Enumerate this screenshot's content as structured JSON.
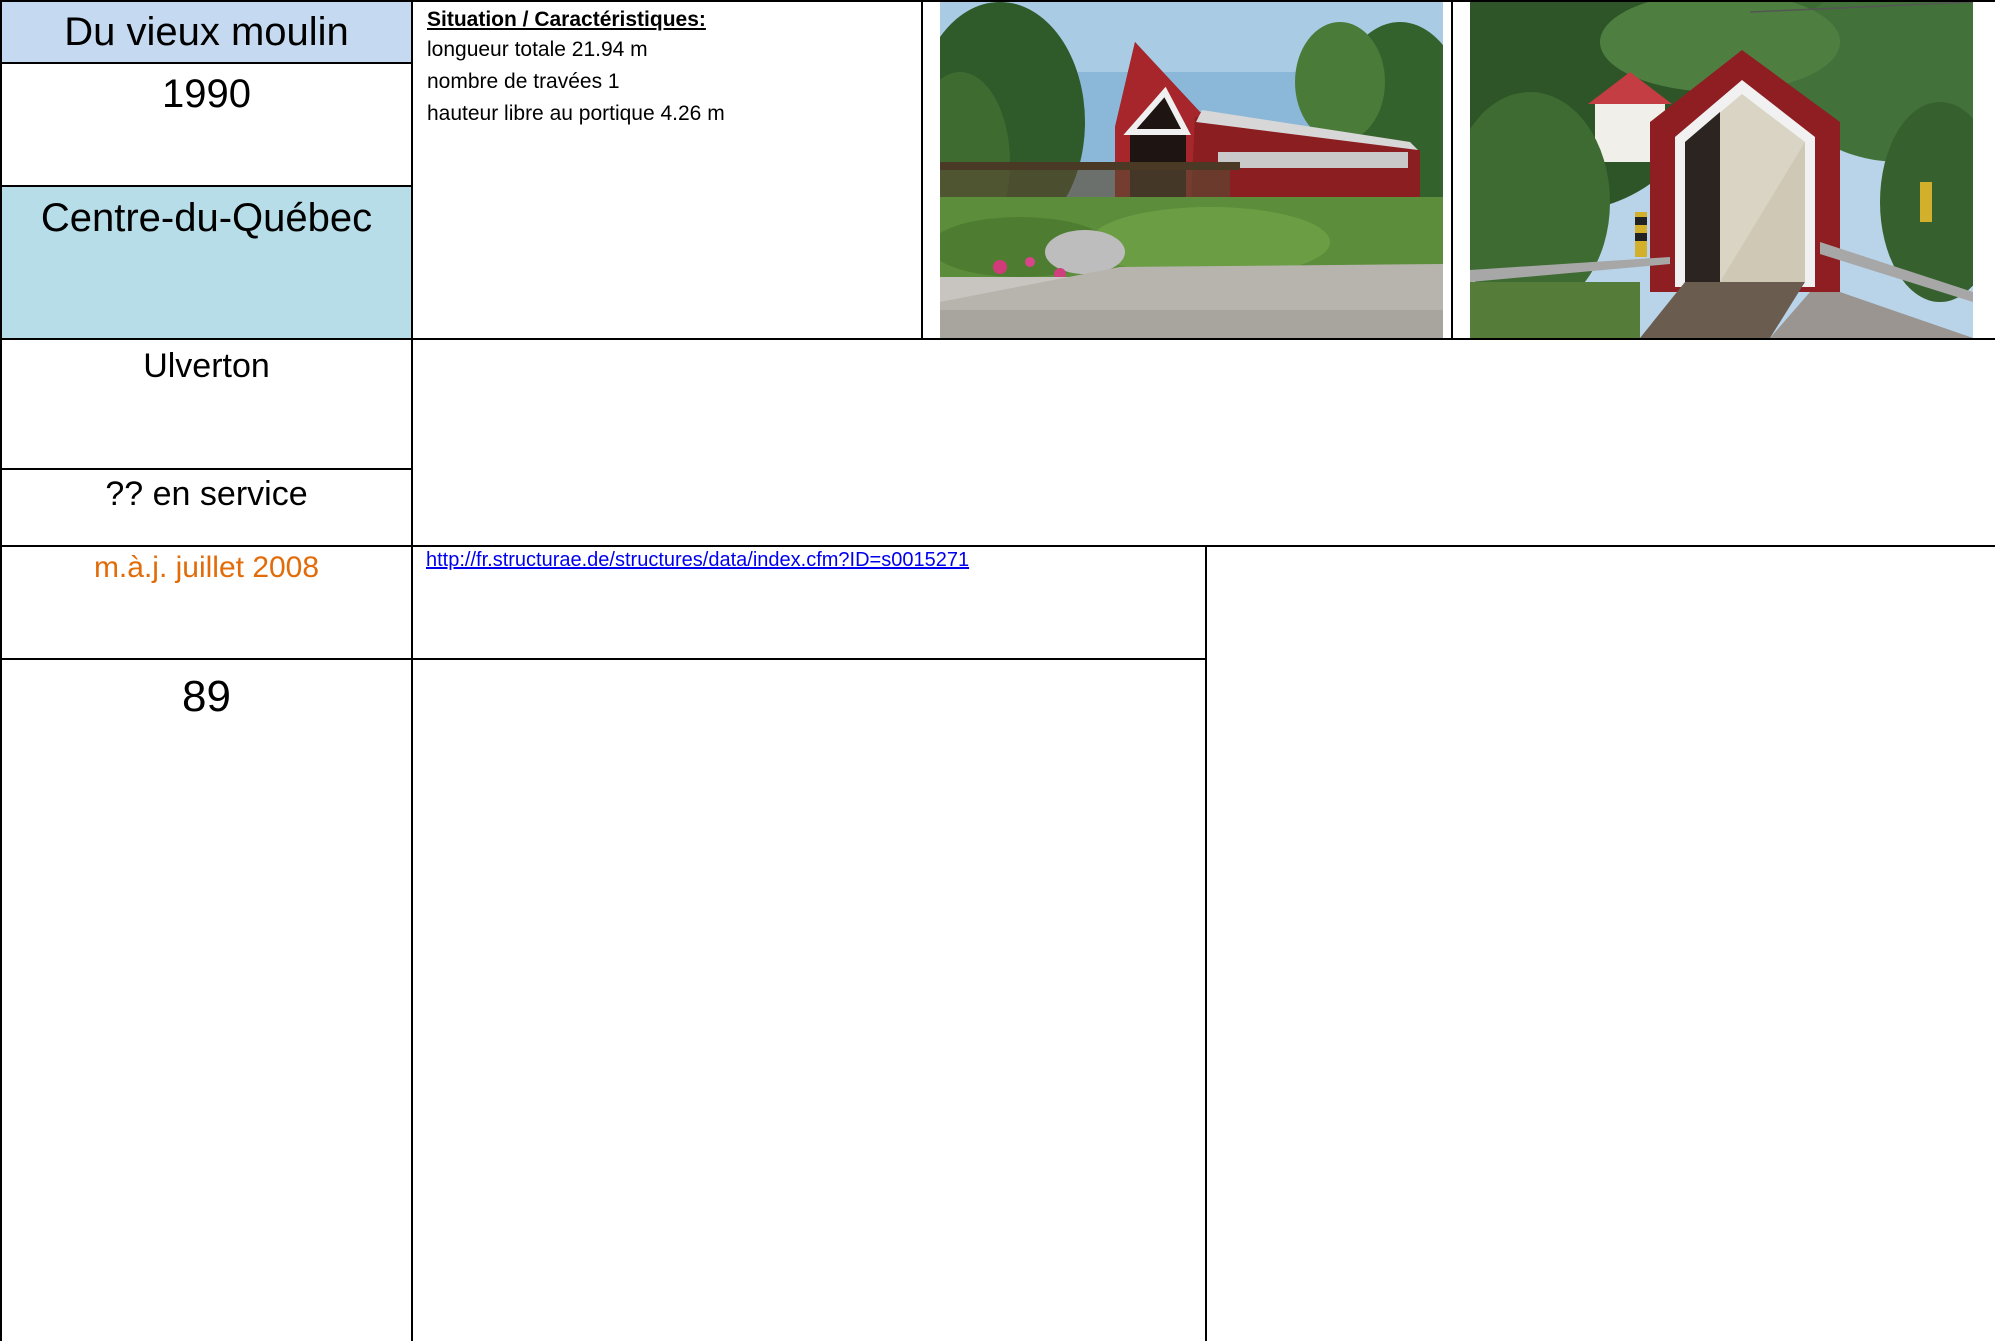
{
  "bridge": {
    "name": "Du vieux moulin",
    "year": "1990",
    "region": "Centre-du-Québec",
    "municipality": "Ulverton",
    "status": "?? en service",
    "updated": "m.à.j. juillet 2008",
    "number": "89"
  },
  "specs": {
    "heading": "Situation / Caractéristiques:",
    "lines": [
      "longueur totale 21.94 m",
      "nombre de travées 1",
      "hauteur libre au portique 4.26 m"
    ]
  },
  "reference": {
    "url": "http://fr.structurae.de/structures/data/index.cfm?ID=s0015271"
  },
  "colors": {
    "title_bg": "#c5d9f1",
    "region_bg": "#b7dde8",
    "updated_text": "#e26b0a",
    "link": "#0000ee"
  },
  "photos": [
    {
      "icon": "covered-bridge-photo-side"
    },
    {
      "icon": "covered-bridge-photo-front"
    }
  ]
}
